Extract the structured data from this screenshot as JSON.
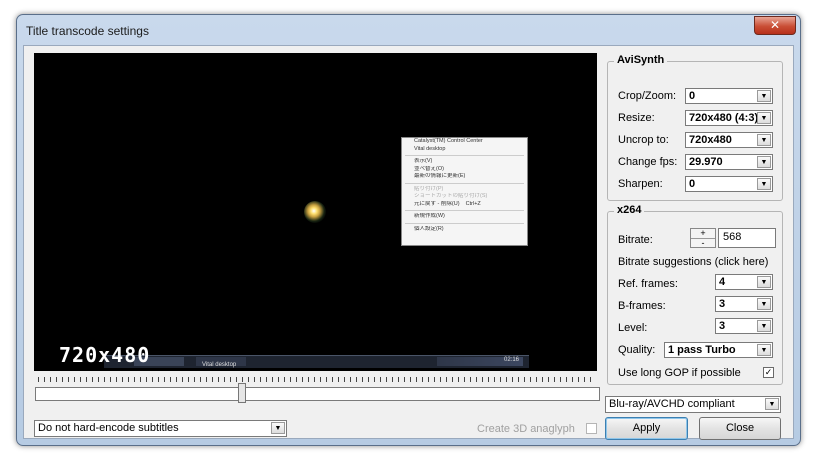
{
  "window": {
    "title": "Title transcode settings",
    "close_glyph": "✕"
  },
  "preview": {
    "resolution_label": "720x480",
    "context_menu": [
      "Catalyst(TM) Control Center",
      "Vital desktop",
      "表示(V)",
      "並べ替え(O)",
      "最新の情報に更新(E)",
      "貼り付け(P)",
      "ショートカットの貼り付け(S)",
      "元に戻す - 削除(U)",
      "新規作成(W)",
      "個人設定(R)"
    ],
    "context_menu_shortcut": "Ctrl+Z",
    "taskbar": {
      "item1": "Vital desktop",
      "clock": "02:16"
    }
  },
  "avisynth": {
    "title": "AviSynth",
    "crop_zoom": {
      "label": "Crop/Zoom:",
      "value": "0"
    },
    "resize": {
      "label": "Resize:",
      "value": "720x480 (4:3)"
    },
    "uncrop": {
      "label": "Uncrop to:",
      "value": "720x480"
    },
    "change_fps": {
      "label": "Change fps:",
      "value": "29.970"
    },
    "sharpen": {
      "label": "Sharpen:",
      "value": "0"
    }
  },
  "x264": {
    "title": "x264",
    "bitrate": {
      "label": "Bitrate:",
      "value": "568",
      "up": "+",
      "down": "-"
    },
    "suggestions": "Bitrate suggestions (click here)",
    "ref_frames": {
      "label": "Ref. frames:",
      "value": "4"
    },
    "b_frames": {
      "label": "B-frames:",
      "value": "3"
    },
    "level": {
      "label": "Level:",
      "value": "3"
    },
    "quality": {
      "label": "Quality:",
      "value": "1 pass Turbo"
    },
    "long_gop": {
      "label": "Use long GOP if possible",
      "check": "✓"
    }
  },
  "bottom": {
    "compliance": "Blu-ray/AVCHD compliant",
    "subtitles": "Do not hard-encode subtitles",
    "anaglyph": "Create 3D anaglyph",
    "apply": "Apply",
    "close": "Close"
  }
}
